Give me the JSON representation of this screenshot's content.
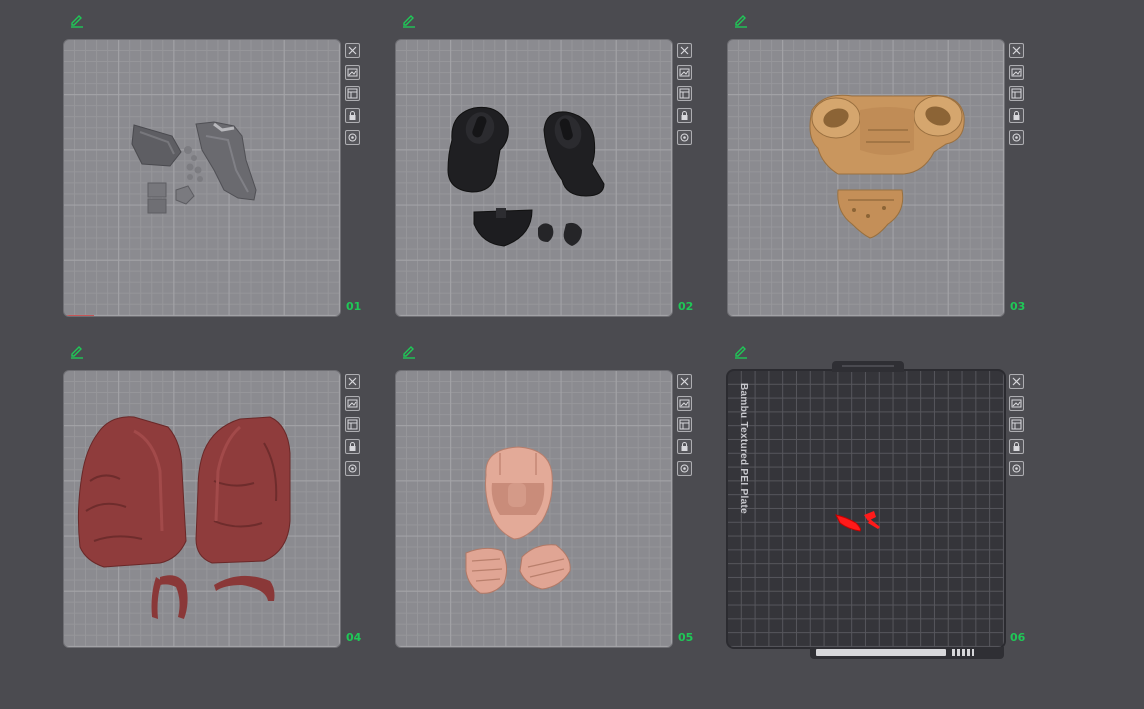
{
  "plates": [
    {
      "number": "01",
      "textured": false
    },
    {
      "number": "02",
      "textured": false
    },
    {
      "number": "03",
      "textured": false
    },
    {
      "number": "04",
      "textured": false
    },
    {
      "number": "05",
      "textured": false
    },
    {
      "number": "06",
      "textured": true,
      "label": "Bambu Textured PEI Plate"
    }
  ],
  "toolbar_icons": [
    "close-icon",
    "arrange-icon",
    "orient-icon",
    "lock-icon",
    "settings-icon"
  ],
  "colors": {
    "background": "#4b4b50",
    "plate_smooth": "#8b8b90",
    "plate_textured": "#35353a",
    "plate_number": "#1fc857",
    "edit_icon": "#1fc857"
  }
}
